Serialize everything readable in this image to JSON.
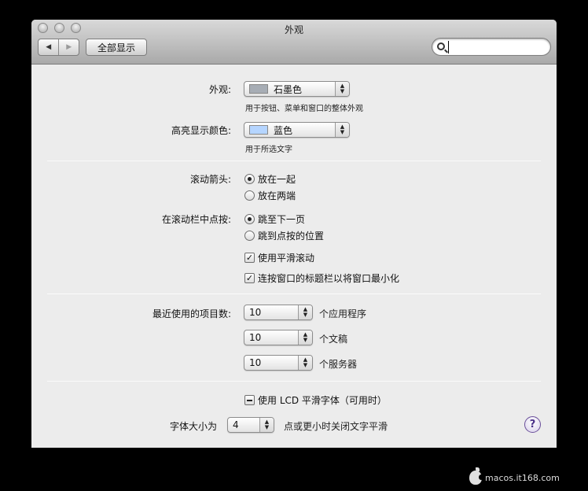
{
  "window": {
    "title": "外观"
  },
  "toolbar": {
    "back_glyph": "◀",
    "forward_glyph": "▶",
    "show_all_label": "全部显示",
    "search": {
      "value": "",
      "placeholder": ""
    }
  },
  "appearance": {
    "label": "外观:",
    "selected": "石墨色",
    "description": "用于按钮、菜单和窗口的整体外观",
    "swatch_color": "#a7adb5"
  },
  "highlight": {
    "label": "高亮显示颜色:",
    "selected": "蓝色",
    "description": "用于所选文字",
    "swatch_color": "#b5d5ff"
  },
  "scroll_arrows": {
    "label": "滚动箭头:",
    "options": [
      "放在一起",
      "放在两端"
    ],
    "selected_index": 0
  },
  "scroll_click": {
    "label": "在滚动栏中点按:",
    "options": [
      "跳至下一页",
      "跳到点按的位置"
    ],
    "selected_index": 0
  },
  "checkboxes": {
    "smooth_scroll": {
      "label": "使用平滑滚动",
      "checked": true
    },
    "double_click_minimize": {
      "label": "连按窗口的标题栏以将窗口最小化",
      "checked": true
    }
  },
  "recent_items": {
    "label": "最近使用的项目数:",
    "rows": [
      {
        "value": "10",
        "suffix": "个应用程序"
      },
      {
        "value": "10",
        "suffix": "个文稿"
      },
      {
        "value": "10",
        "suffix": "个服务器"
      }
    ]
  },
  "font_smoothing": {
    "label": "使用 LCD 平滑字体（可用时）",
    "state": "mixed",
    "size_prefix": "字体大小为",
    "size_value": "4",
    "size_suffix": "点或更小时关闭文字平滑"
  },
  "help": {
    "glyph": "?"
  },
  "watermark": {
    "text": "macos.it168.com"
  }
}
